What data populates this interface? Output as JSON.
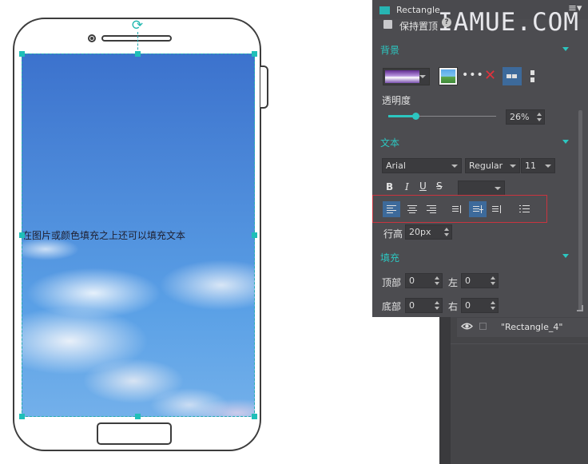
{
  "canvas": {
    "screen_text": "在图片或颜色填充之上还可以填充文本",
    "sky_color": "#3c72cd"
  },
  "panel": {
    "title": "Rectangle",
    "keep_on_top_label": "保持置顶",
    "watermark": "IAMUE.COM",
    "help_icon": "?",
    "accent_color": "#2cc6c0",
    "background_section": {
      "label": "背景",
      "opacity_label": "透明度",
      "opacity_value": "26%",
      "opacity_fraction": 0.26
    },
    "text_section": {
      "label": "文本",
      "font_family": "Arial",
      "font_weight": "Regular",
      "font_size": "11",
      "bold": "B",
      "italic": "I",
      "underline": "U",
      "strikethrough": "S",
      "line_height_label": "行高",
      "line_height_value": "20px"
    },
    "fill_section": {
      "label": "填充",
      "top_label": "顶部",
      "top_value": "0",
      "left_label": "左",
      "left_value": "0",
      "bottom_label": "底部",
      "bottom_value": "0",
      "right_label": "右",
      "right_value": "0"
    }
  },
  "layers": {
    "items": [
      {
        "name": "\"Rectangle_4\""
      }
    ]
  },
  "icons": [
    "rotate-icon",
    "camera-icon",
    "gradient-swatch-icon",
    "image-swatch-icon",
    "more-icon",
    "delete-icon",
    "fill-mode-icon",
    "panel-menu-icon",
    "eye-icon"
  ]
}
